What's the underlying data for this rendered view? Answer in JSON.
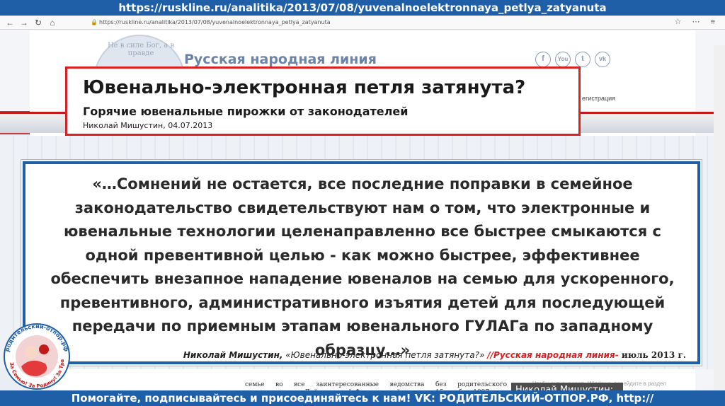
{
  "header_url": "https://ruskline.ru/analitika/2013/07/08/yuvenalnoelektronnaya_petlya_zatyanuta",
  "browser": {
    "url": "https://ruskline.ru/analitika/2013/07/08/yuvenalnoelektronnaya_petlya_zatyanuta"
  },
  "site": {
    "name": "Русская народная линия",
    "seal_motto": "Не в силе Бог, а в правде",
    "registration": "егистрация",
    "social": [
      "f",
      "You",
      "t",
      "vk"
    ]
  },
  "article": {
    "title": "Ювенально-электронная петля затянута?",
    "subtitle": "Горячие ювенальные пирожки от законодателей",
    "byline": "Николай Мишустин, 04.07.2013"
  },
  "quote": {
    "text": "«…Сомнений не остается, все последние поправки в семейное законодательство свидетельствуют нам о том, что электронные и ювенальные технологии целенаправленно все быстрее смыкаются с одной превентивной целью - как можно быстрее, эффективнее обеспечить внезапное нападение ювеналов на семью для ускоренного, превентивного, административного изъятия детей для последующей передачи по приемным этапам ювенального ГУЛАГа по западному образцу…»",
    "author": "Николай Мишустин,",
    "work": " «Ювенально-электронная петля затянута?» ",
    "source": "//Русская народная линия- ",
    "date": "июль 2013 г."
  },
  "article_excerpt": "семье во все заинтересованные ведомства без родительского волеизъявления. Действующий Федеральный закон от 15 ноября 1997 года № 143-ФЗ «Об актах гражданского состояния»",
  "activation_notice": "Чтобы активировать Windows, перейдите в раздел \"Параметры\".",
  "author_card": "Николай Мишустин:",
  "stamp_text": "родительский-отпор.рф За Семью! За Родину! За Традиции!",
  "footer": "Помогайте, подписывайтесь и присоединяйтесь к нам! VK: РОДИТЕЛЬСКИЙ-ОТПОР.РФ, http://родительскийотпор.рф",
  "colors": {
    "brand_blue": "#1f5fa8",
    "accent_red": "#d62222"
  }
}
